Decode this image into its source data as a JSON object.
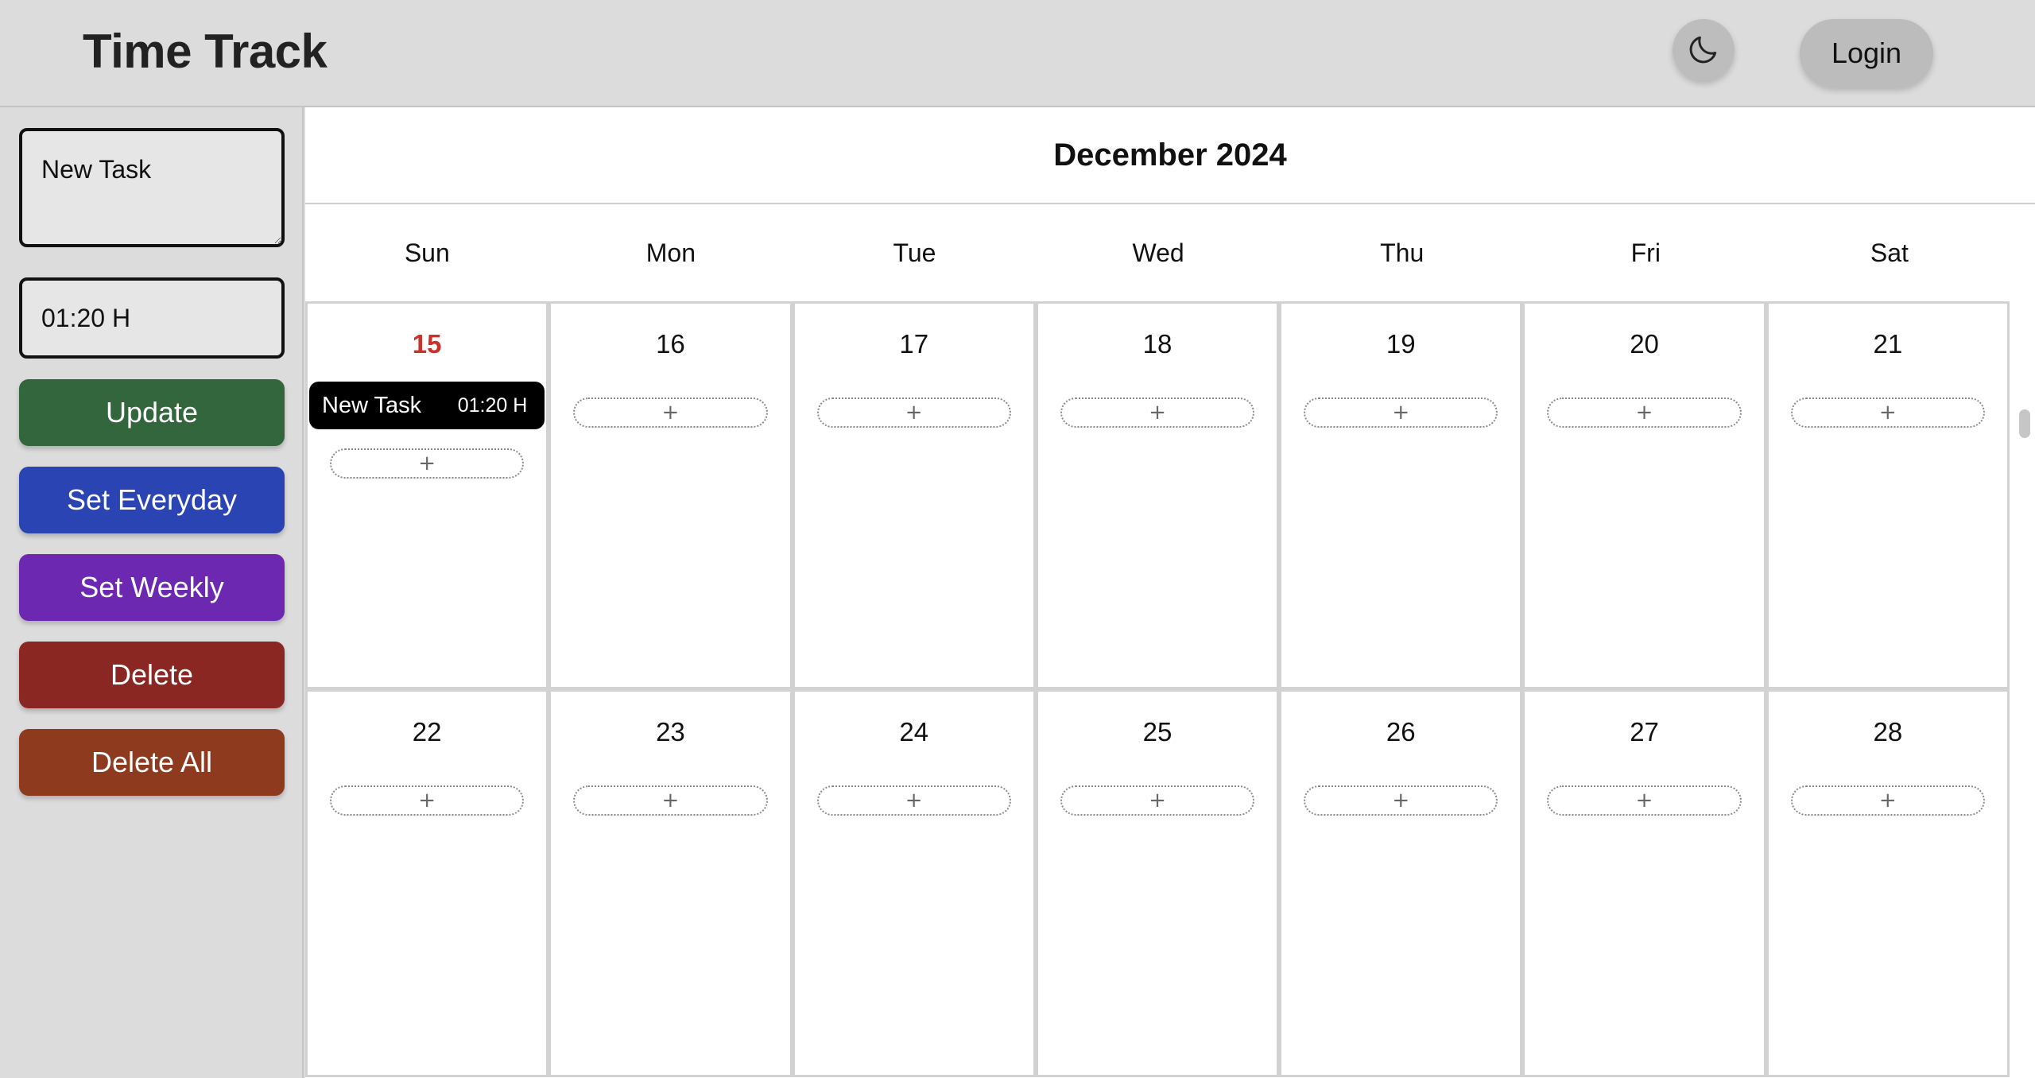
{
  "header": {
    "title": "Time Track",
    "theme_icon": "moon-icon",
    "login_label": "Login"
  },
  "sidebar": {
    "task_input_value": "New Task",
    "time_input_value": "01:20 H",
    "buttons": {
      "update": "Update",
      "everyday": "Set Everyday",
      "weekly": "Set Weekly",
      "delete": "Delete",
      "delete_all": "Delete All"
    },
    "colors": {
      "update": "#33663d",
      "everyday": "#2b44b4",
      "weekly": "#6c28b0",
      "delete": "#8b2722",
      "delete_all": "#8d3a1f"
    }
  },
  "calendar": {
    "month_title": "December 2024",
    "weekdays": [
      "Sun",
      "Mon",
      "Tue",
      "Wed",
      "Thu",
      "Fri",
      "Sat"
    ],
    "add_label": "+",
    "today_color": "#c8322a",
    "weeks": [
      [
        {
          "day": "15",
          "today": true,
          "tasks": [
            {
              "name": "New Task",
              "time": "01:20 H"
            }
          ]
        },
        {
          "day": "16",
          "tasks": []
        },
        {
          "day": "17",
          "tasks": []
        },
        {
          "day": "18",
          "tasks": []
        },
        {
          "day": "19",
          "tasks": []
        },
        {
          "day": "20",
          "tasks": []
        },
        {
          "day": "21",
          "tasks": []
        }
      ],
      [
        {
          "day": "22",
          "tasks": []
        },
        {
          "day": "23",
          "tasks": []
        },
        {
          "day": "24",
          "tasks": []
        },
        {
          "day": "25",
          "tasks": []
        },
        {
          "day": "26",
          "tasks": []
        },
        {
          "day": "27",
          "tasks": []
        },
        {
          "day": "28",
          "tasks": []
        }
      ]
    ]
  }
}
